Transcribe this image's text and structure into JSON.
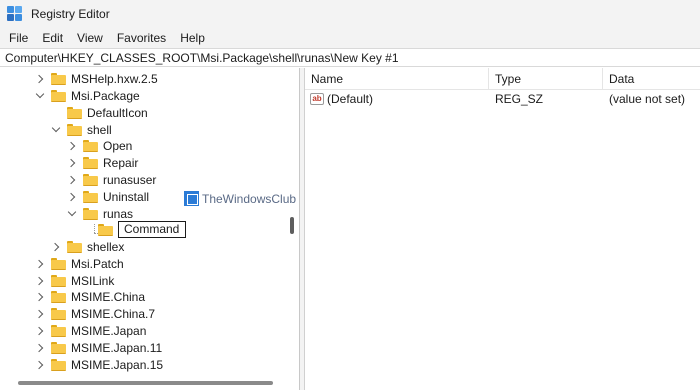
{
  "window": {
    "title": "Registry Editor"
  },
  "menu": [
    "File",
    "Edit",
    "View",
    "Favorites",
    "Help"
  ],
  "address": "Computer\\HKEY_CLASSES_ROOT\\Msi.Package\\shell\\runas\\New Key #1",
  "tree": [
    {
      "label": "MSHelp.hxw.2.5",
      "state": "collapsed"
    },
    {
      "label": "Msi.Package",
      "state": "expanded"
    },
    {
      "label": "DefaultIcon",
      "state": "leaf"
    },
    {
      "label": "shell",
      "state": "expanded"
    },
    {
      "label": "Open",
      "state": "collapsed"
    },
    {
      "label": "Repair",
      "state": "collapsed"
    },
    {
      "label": "runasuser",
      "state": "collapsed"
    },
    {
      "label": "Uninstall",
      "state": "collapsed"
    },
    {
      "label": "runas",
      "state": "expanded"
    },
    {
      "label": "Command",
      "state": "editing"
    },
    {
      "label": "shellex",
      "state": "collapsed"
    },
    {
      "label": "Msi.Patch",
      "state": "collapsed"
    },
    {
      "label": "MSILink",
      "state": "collapsed"
    },
    {
      "label": "MSIME.China",
      "state": "collapsed"
    },
    {
      "label": "MSIME.China.7",
      "state": "collapsed"
    },
    {
      "label": "MSIME.Japan",
      "state": "collapsed"
    },
    {
      "label": "MSIME.Japan.11",
      "state": "collapsed"
    },
    {
      "label": "MSIME.Japan.15",
      "state": "collapsed"
    }
  ],
  "watermark": "TheWindowsClub",
  "list": {
    "columns": [
      "Name",
      "Type",
      "Data"
    ],
    "rows": [
      {
        "icon": "ab",
        "name": "(Default)",
        "type": "REG_SZ",
        "data": "(value not set)"
      }
    ]
  },
  "colors": {
    "folder": "#f8c94a",
    "accent": "#2b7bd6"
  }
}
